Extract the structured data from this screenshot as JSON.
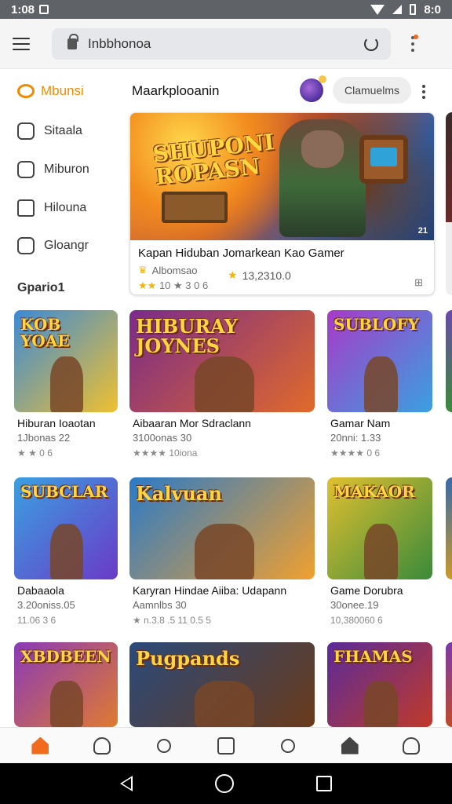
{
  "status": {
    "time": "1:08",
    "right": "8:0"
  },
  "toolbar": {
    "url": "Inbbhonoa"
  },
  "sidebar": {
    "brand": "Mbunsi",
    "items": [
      {
        "label": "Sitaala",
        "icon": "puzzle-icon"
      },
      {
        "label": "Miburon",
        "icon": "face-icon"
      },
      {
        "label": "Hilouna",
        "icon": "house-icon"
      },
      {
        "label": "Gloangr",
        "icon": "sparkle-icon"
      }
    ],
    "section": "Gpario1"
  },
  "main": {
    "title": "Maarkplooanin",
    "chip": "Clamuelms"
  },
  "featured": {
    "logo": "SHUPONI\nROPASN",
    "title": "Kapan Hiduban Jomarkean Kao Gamer",
    "meta": "Albomsao",
    "rating_text": "10 ★ 3 0 6",
    "rating2": "13,2310.0",
    "badge": "21",
    "flag": "⊞"
  },
  "cards": [
    {
      "logo": "KOB YOAE",
      "title": "Hiburan Ioaotan",
      "sub": "1Jbonas 22",
      "rating": "★ ★ 0 6",
      "colors": [
        "#3a8ad8",
        "#f0c030"
      ]
    },
    {
      "logo": "HIBURAY JOYNES",
      "title": "Aibaaran Mor Sdraclann",
      "sub": "3100onas 30",
      "rating": "★★★★ 10iona",
      "colors": [
        "#7a2a8a",
        "#e06a2a"
      ]
    },
    {
      "logo": "SUBLOFY",
      "title": "Gamar Nam",
      "sub": "20nni: 1.33",
      "rating": "★★★★ 0 6",
      "colors": [
        "#a83ac8",
        "#3aa0e0"
      ]
    },
    {
      "logo": "SUBCLAR",
      "title": "Dabaaola",
      "sub": "3.20oniss.05",
      "rating": "11.06 3 6",
      "colors": [
        "#3aa0e0",
        "#6a3ac8"
      ]
    },
    {
      "logo": "Kalvuan",
      "title": "Karyran Hindae Aiiba: Udapann",
      "sub": "Aamnlbs 30",
      "rating": "★ n.3.8 .5 11 0.5 5",
      "colors": [
        "#2a7ac8",
        "#f0a030"
      ]
    },
    {
      "logo": "MAKAOR",
      "title": "Game Dorubra",
      "sub": "30onee.19",
      "rating": "10,380060 6",
      "colors": [
        "#e0c030",
        "#3a8a3a"
      ]
    },
    {
      "logo": "XBDBEEN",
      "title": "",
      "sub": "",
      "rating": "",
      "colors": [
        "#8a3ab8",
        "#e07a30"
      ]
    },
    {
      "logo": "Pugpands",
      "title": "",
      "sub": "",
      "rating": "",
      "colors": [
        "#2a4a7a",
        "#6a3a1a"
      ]
    },
    {
      "logo": "FHAMAS",
      "title": "",
      "sub": "",
      "rating": "",
      "colors": [
        "#5a2a9a",
        "#c03a2a"
      ]
    }
  ],
  "nav": [
    "home-icon",
    "profile-icon",
    "controller-icon",
    "grid-icon",
    "search-icon",
    "house-icon",
    "account-icon"
  ]
}
